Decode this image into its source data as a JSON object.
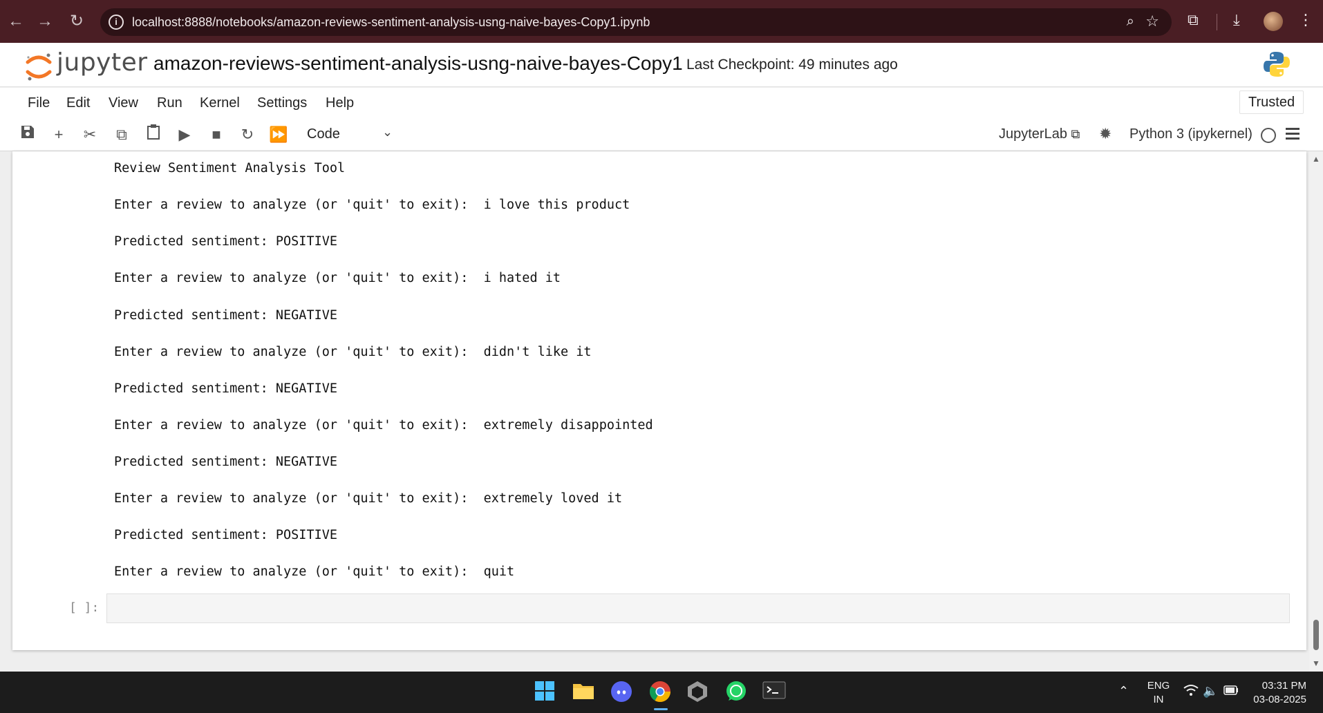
{
  "browser": {
    "url": "localhost:8888/notebooks/amazon-reviews-sentiment-analysis-usng-naive-bayes-Copy1.ipynb"
  },
  "header": {
    "logo_text": "jupyter",
    "notebook_title": "amazon-reviews-sentiment-analysis-usng-naive-bayes-Copy1",
    "checkpoint": "Last Checkpoint: 49 minutes ago"
  },
  "menu": {
    "items": [
      "File",
      "Edit",
      "View",
      "Run",
      "Kernel",
      "Settings",
      "Help"
    ],
    "trusted": "Trusted"
  },
  "toolbar": {
    "cell_type": "Code",
    "jupyterlab_link": "JupyterLab",
    "kernel": "Python 3 (ipykernel)"
  },
  "output_lines": [
    "Review Sentiment Analysis Tool",
    "Enter a review to analyze (or 'quit' to exit):  i love this product",
    "Predicted sentiment: POSITIVE",
    "Enter a review to analyze (or 'quit' to exit):  i hated it",
    "Predicted sentiment: NEGATIVE",
    "Enter a review to analyze (or 'quit' to exit):  didn't like it",
    "Predicted sentiment: NEGATIVE",
    "Enter a review to analyze (or 'quit' to exit):  extremely disappointed",
    "Predicted sentiment: NEGATIVE",
    "Enter a review to analyze (or 'quit' to exit):  extremely loved it",
    "Predicted sentiment: POSITIVE",
    "Enter a review to analyze (or 'quit' to exit):  quit"
  ],
  "empty_cell": {
    "prompt": "[ ]:"
  },
  "taskbar": {
    "lang_top": "ENG",
    "lang_bottom": "IN",
    "time": "03:31 PM",
    "date": "03-08-2025"
  }
}
